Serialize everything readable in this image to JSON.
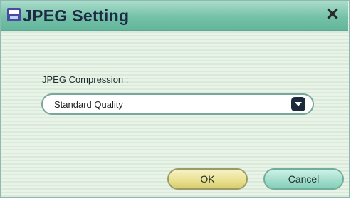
{
  "window": {
    "title": "JPEG Setting",
    "close_symbol": "✕"
  },
  "form": {
    "compression_label": "JPEG Compression :",
    "compression_value": "Standard Quality"
  },
  "buttons": {
    "ok_label": "OK",
    "cancel_label": "Cancel"
  },
  "colors": {
    "titlebar": "#74c1a8",
    "ok_button": "#e9e08e",
    "cancel_button": "#9fdcca"
  }
}
